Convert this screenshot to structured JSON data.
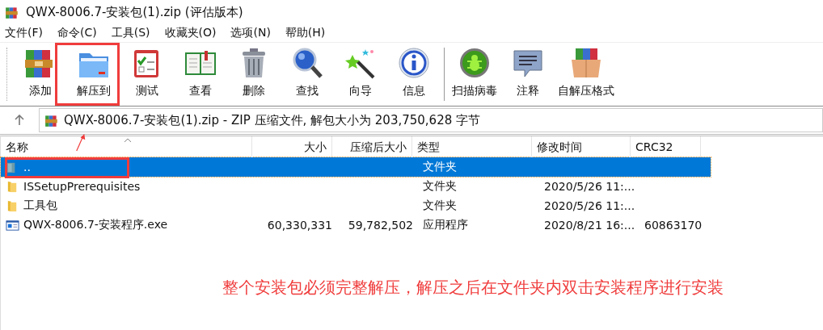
{
  "window": {
    "title": "QWX-8006.7-安装包(1).zip (评估版本)"
  },
  "menu": [
    "文件(F)",
    "命令(C)",
    "工具(S)",
    "收藏夹(O)",
    "选项(N)",
    "帮助(H)"
  ],
  "toolbar": [
    [
      {
        "label": "添加",
        "kind": "books"
      },
      {
        "label": "解压到",
        "kind": "folder"
      },
      {
        "label": "测试",
        "kind": "checklist"
      },
      {
        "label": "查看",
        "kind": "book"
      },
      {
        "label": "删除",
        "kind": "trash"
      },
      {
        "label": "查找",
        "kind": "magnifier"
      },
      {
        "label": "向导",
        "kind": "wand"
      },
      {
        "label": "信息",
        "kind": "info"
      }
    ],
    [
      {
        "label": "扫描病毒",
        "kind": "bug"
      },
      {
        "label": "注释",
        "kind": "comment"
      },
      {
        "label": "自解压格式",
        "kind": "box"
      }
    ]
  ],
  "address": "QWX-8006.7-安装包(1).zip - ZIP 压缩文件, 解包大小为 203,750,628 字节",
  "table": {
    "columns": [
      "名称",
      "大小",
      "压缩后大小",
      "类型",
      "修改时间",
      "CRC32"
    ],
    "rows": [
      {
        "kind": "up",
        "cells": [
          "..",
          "",
          "",
          "文件夹",
          "",
          ""
        ],
        "selected": true
      },
      {
        "kind": "folder",
        "cells": [
          "ISSetupPrerequisites",
          "",
          "",
          "文件夹",
          "2020/5/26 11:...",
          ""
        ],
        "selected": false
      },
      {
        "kind": "folder",
        "cells": [
          "工具包",
          "",
          "",
          "文件夹",
          "2020/5/26 11:...",
          ""
        ],
        "selected": false
      },
      {
        "kind": "exe",
        "cells": [
          "QWX-8006.7-安装程序.exe",
          "60,330,331",
          "59,782,502",
          "应用程序",
          "2020/8/21 16:...",
          "60863170"
        ],
        "selected": false
      }
    ]
  },
  "note": "整个安装包必须完整解压，解压之后在文件夹内双击安装程序进行安装"
}
